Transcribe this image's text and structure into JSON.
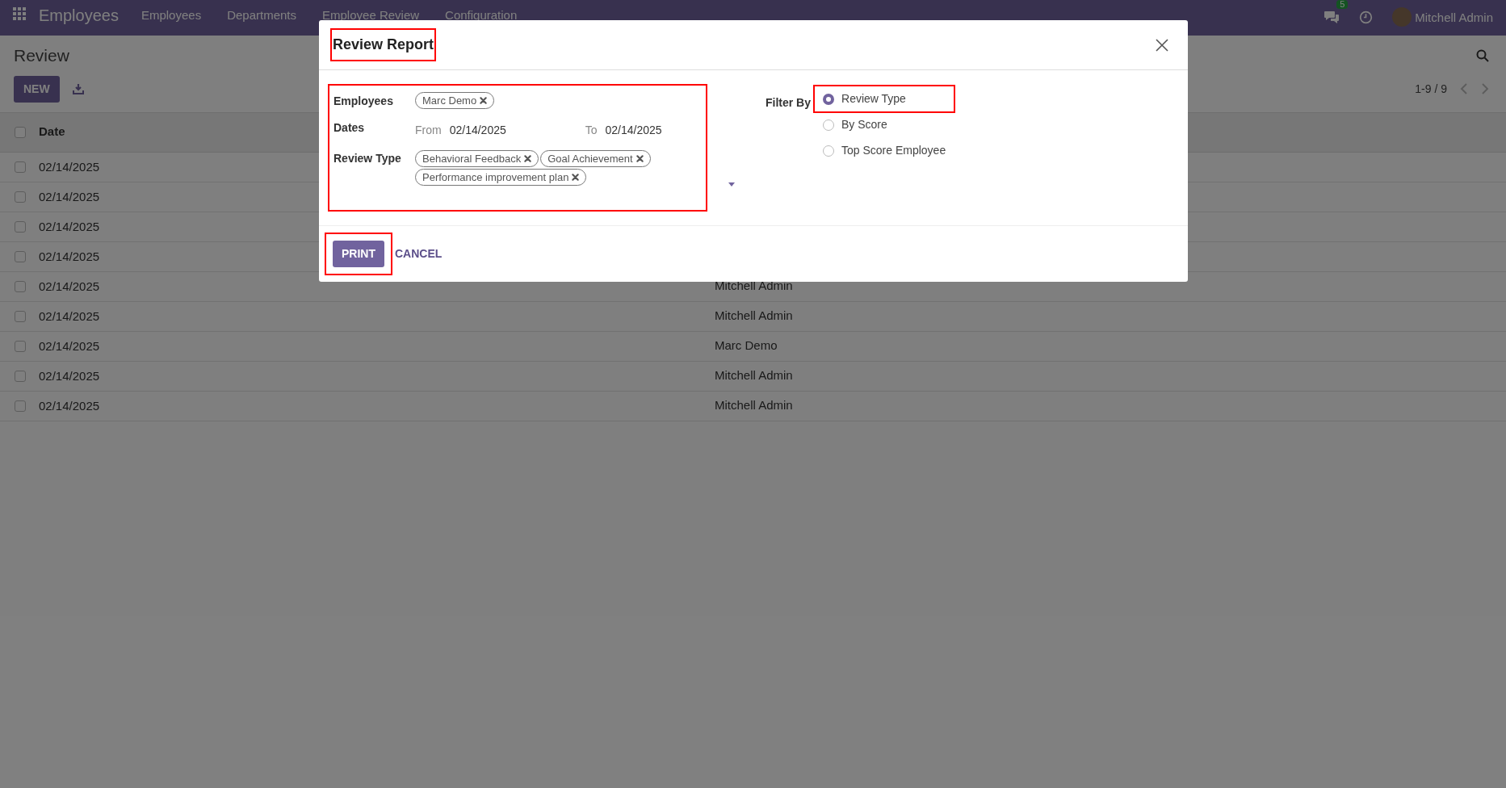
{
  "navbar": {
    "app_name": "Employees",
    "menu": [
      "Employees",
      "Departments",
      "Employee Review",
      "Configuration"
    ],
    "chat_badge": "5",
    "user": "Mitchell Admin"
  },
  "control_panel": {
    "title": "Review",
    "new_button": "NEW",
    "pager": "1-9 / 9"
  },
  "table": {
    "columns": [
      "Date"
    ],
    "select_all_checked": false,
    "rows": [
      {
        "date": "02/14/2025",
        "checked": false
      },
      {
        "date": "02/14/2025",
        "checked": false
      },
      {
        "date": "02/14/2025",
        "checked": false
      },
      {
        "date": "02/14/2025",
        "checked": false
      },
      {
        "date": "02/14/2025",
        "employee": "Mitchell Admin",
        "checked": false
      },
      {
        "date": "02/14/2025",
        "employee": "Mitchell Admin",
        "checked": false
      },
      {
        "date": "02/14/2025",
        "employee": "Marc Demo",
        "checked": false
      },
      {
        "date": "02/14/2025",
        "employee": "Mitchell Admin",
        "checked": false
      },
      {
        "date": "02/14/2025",
        "employee": "Mitchell Admin",
        "checked": false
      }
    ]
  },
  "dialog": {
    "title": "Review Report",
    "title_highlighted": true,
    "fields_highlighted": true,
    "employees": {
      "label": "Employees",
      "tags": [
        "Marc Demo"
      ]
    },
    "dates": {
      "label": "Dates",
      "from_label": "From",
      "from": "02/14/2025",
      "to_label": "To",
      "to": "02/14/2025"
    },
    "review_type": {
      "label": "Review Type",
      "tags": [
        "Behavioral Feedback",
        "Goal Achievement",
        "Performance improvement plan"
      ]
    },
    "filter": {
      "label": "Filter By",
      "options": [
        {
          "label": "Review Type",
          "selected": true,
          "highlighted": true
        },
        {
          "label": "By Score",
          "selected": false,
          "highlighted": false
        },
        {
          "label": "Top Score Employee",
          "selected": false,
          "highlighted": false
        }
      ]
    },
    "print_button": {
      "label": "PRINT",
      "highlighted": true
    },
    "cancel_button": {
      "label": "CANCEL"
    }
  }
}
